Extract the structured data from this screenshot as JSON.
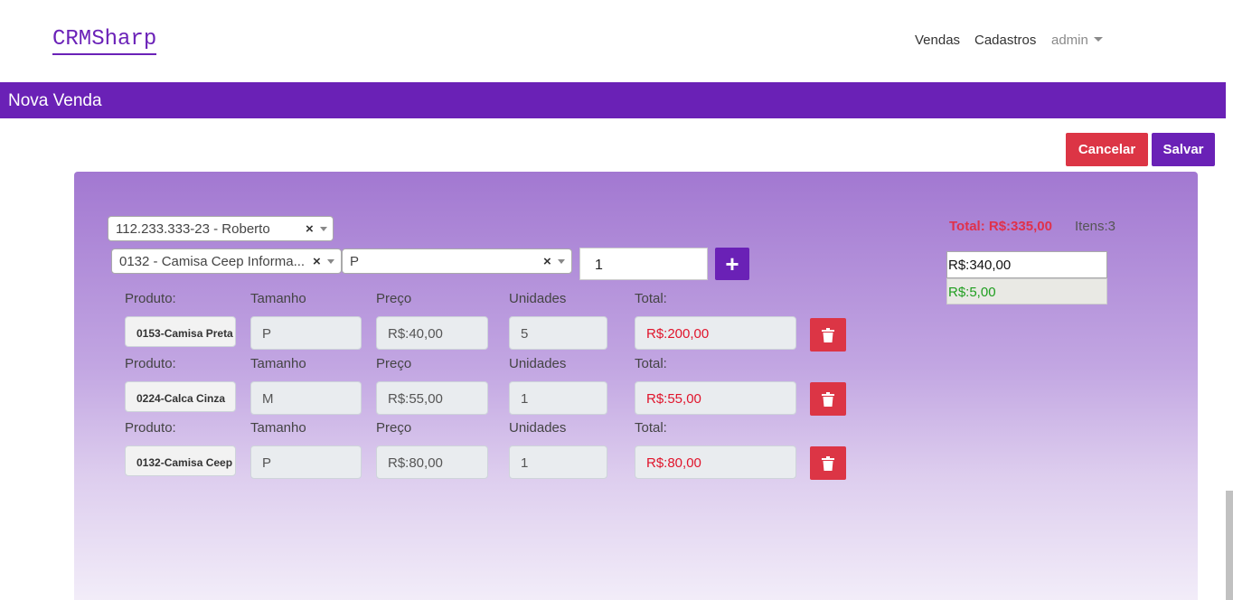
{
  "brand": "CRMSharp",
  "nav": {
    "vendas": "Vendas",
    "cadastros": "Cadastros",
    "user": "admin"
  },
  "page_title": "Nova Venda",
  "actions": {
    "cancel": "Cancelar",
    "save": "Salvar"
  },
  "form": {
    "customer": "112.233.333-23 - Roberto",
    "product": "0132 - Camisa Ceep Informa...",
    "size": "P",
    "quantity": "1",
    "add_symbol": "+"
  },
  "summary": {
    "total": "Total: R$:335,00",
    "items": "Itens:3",
    "paid": "R$:340,00",
    "change": "R$:5,00"
  },
  "labels": {
    "produto": "Produto:",
    "tamanho": "Tamanho",
    "preco": "Preço",
    "unidades": "Unidades",
    "total": "Total:"
  },
  "items": [
    {
      "produto": "0153-Camisa Preta",
      "tamanho": "P",
      "preco": "R$:40,00",
      "unidades": "5",
      "total": "R$:200,00"
    },
    {
      "produto": "0224-Calca Cinza",
      "tamanho": "M",
      "preco": "R$:55,00",
      "unidades": "1",
      "total": "R$:55,00"
    },
    {
      "produto": "0132-Camisa Ceep",
      "tamanho": "P",
      "preco": "R$:80,00",
      "unidades": "1",
      "total": "R$:80,00"
    }
  ],
  "colors": {
    "accent": "#6a21b6",
    "danger": "#dc3545",
    "success": "#1f9e1f"
  }
}
